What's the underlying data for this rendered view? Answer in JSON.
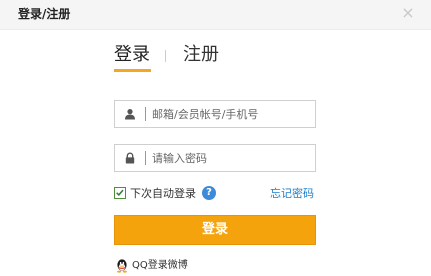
{
  "dialog": {
    "title": "登录/注册",
    "close_glyph": "×"
  },
  "tabs": {
    "login_label": "登录",
    "register_label": "注册",
    "active": "login",
    "accent_color": "#f5a623"
  },
  "username": {
    "icon": "user-icon",
    "value": "",
    "placeholder": "邮箱/会员帐号/手机号"
  },
  "password": {
    "icon": "lock-icon",
    "value": "",
    "placeholder": "请输入密码"
  },
  "remember": {
    "label": "下次自动登录",
    "checked": true,
    "help_glyph": "?"
  },
  "forgot_label": "忘记密码",
  "submit_label": "登录",
  "submit_color": "#f5a30c",
  "qq": {
    "icon": "qq-penguin-icon",
    "label": "QQ登录微博"
  }
}
